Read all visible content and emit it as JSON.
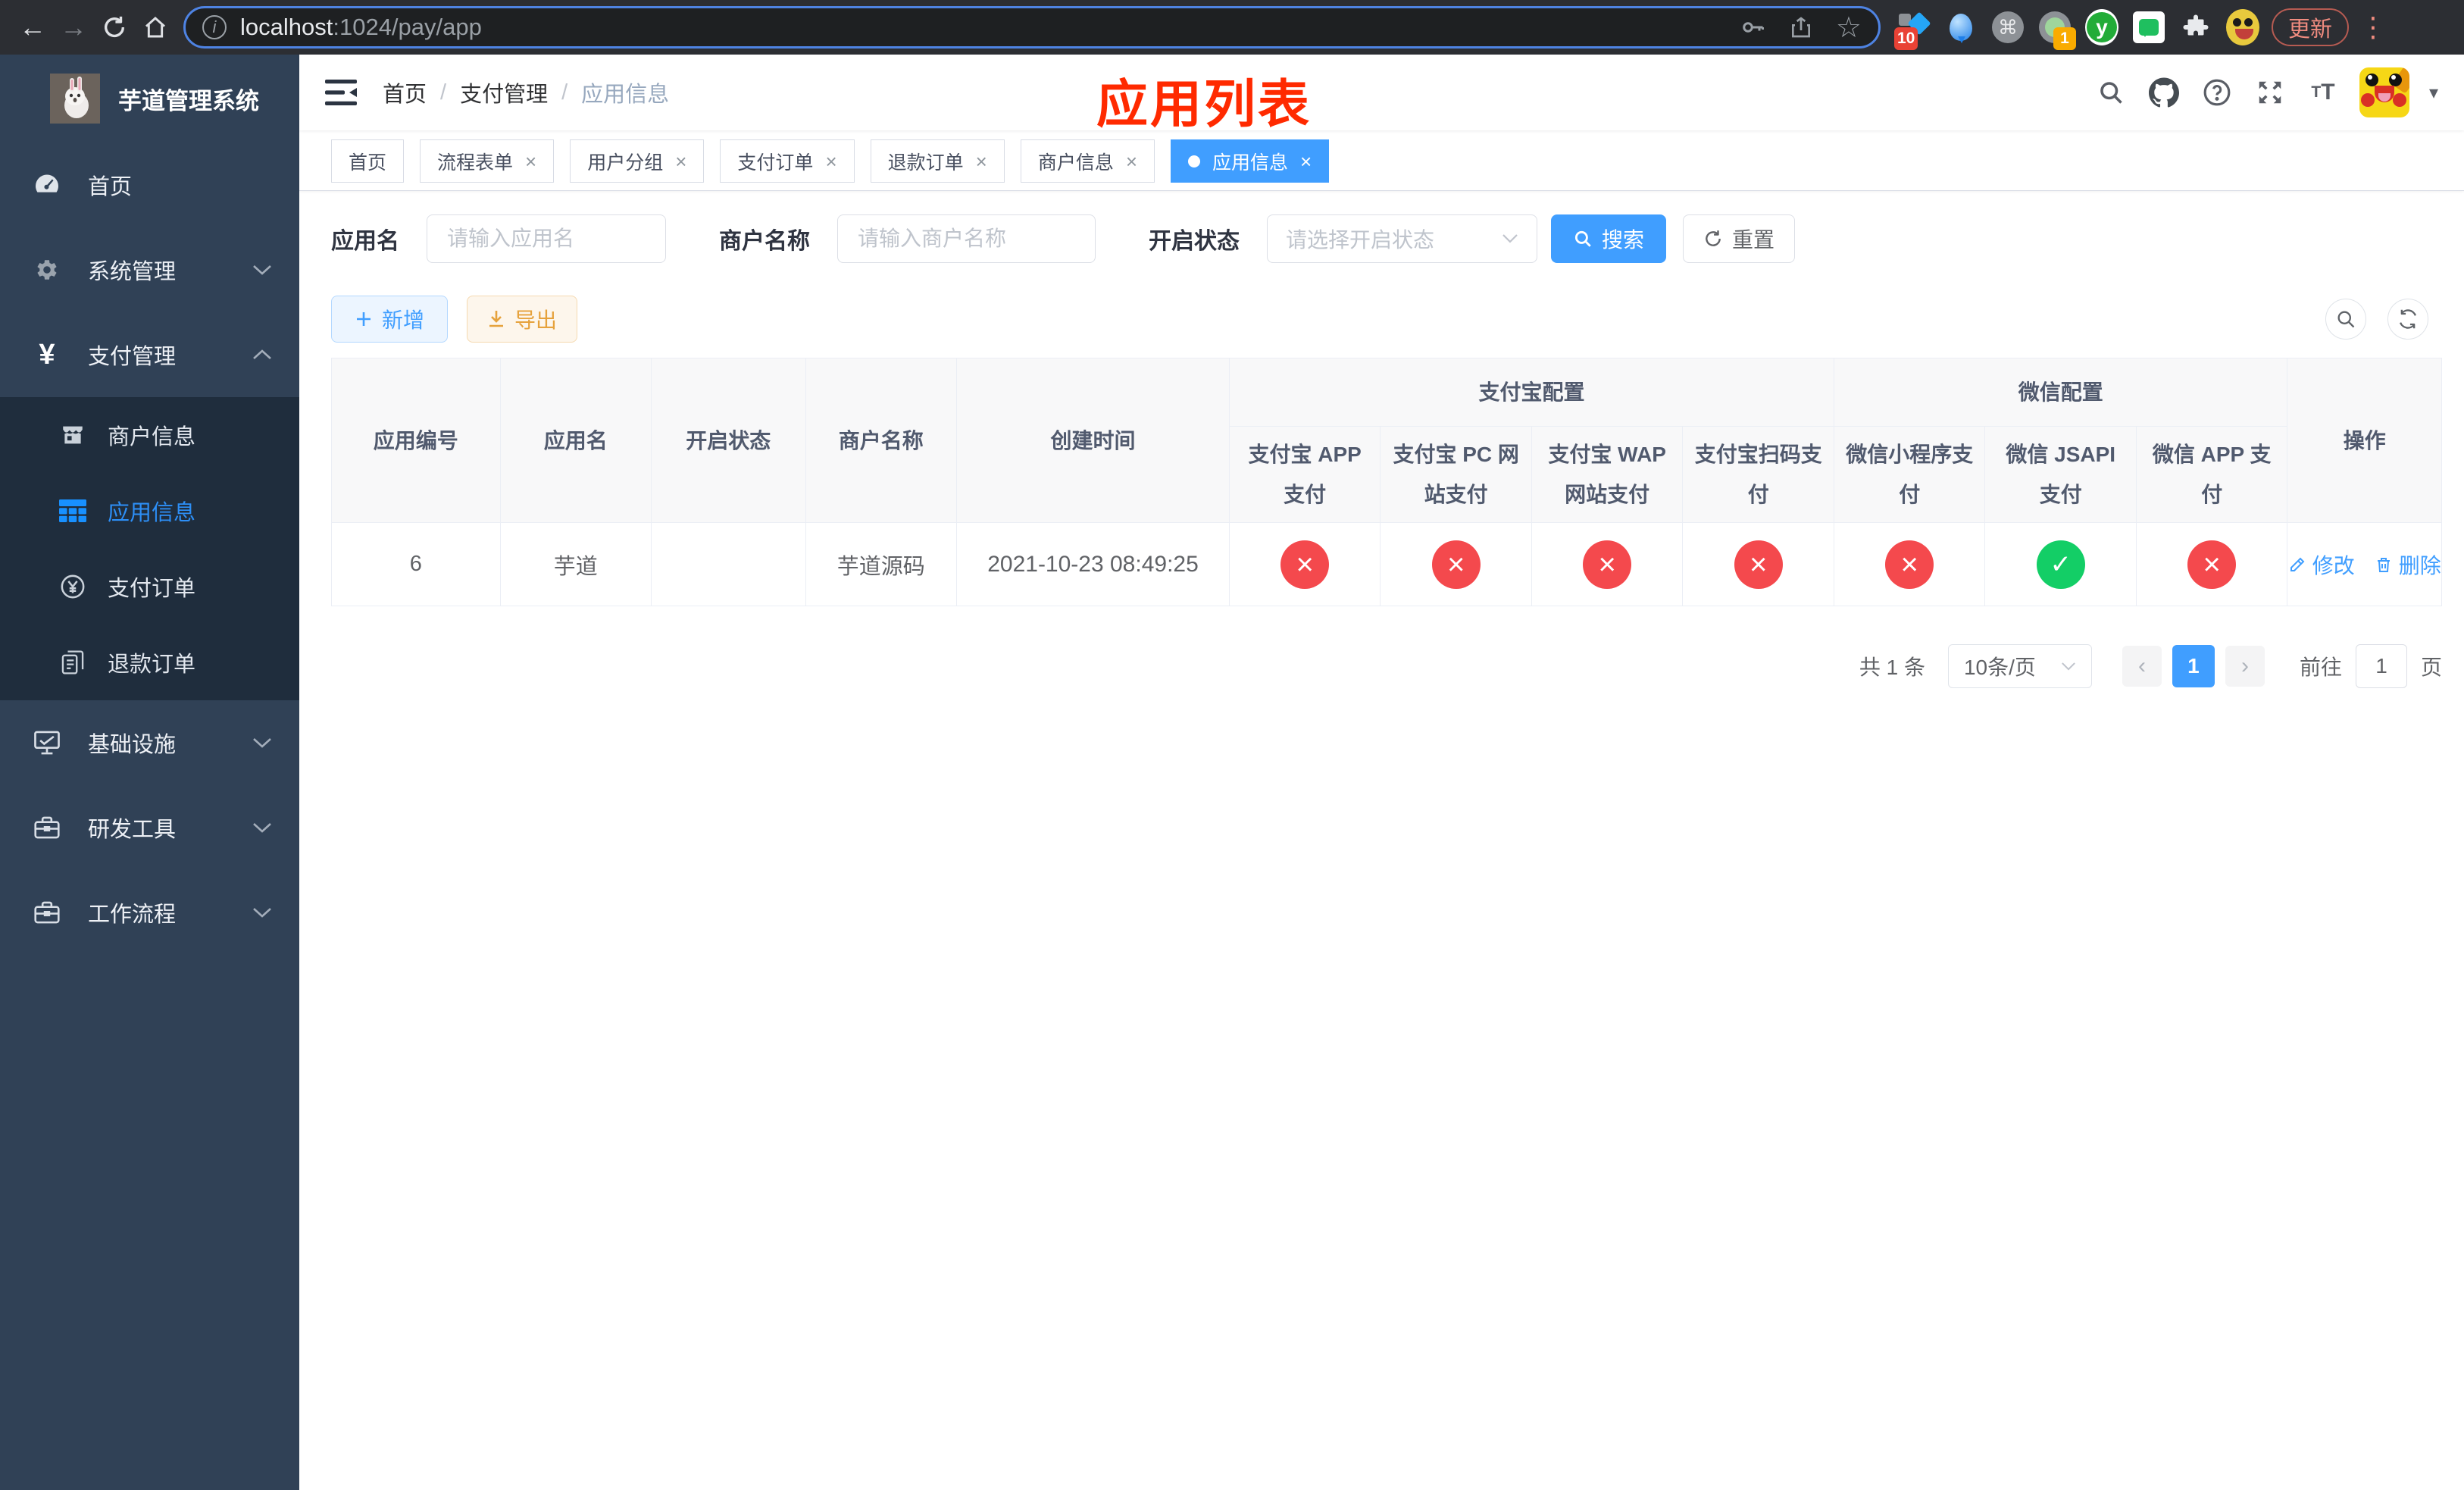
{
  "colors": {
    "accent": "#409eff",
    "success": "#13ce66",
    "danger": "#f4494d",
    "warning": "#e6a23c",
    "annotation_red": "#ff2a00",
    "sidebar_bg": "#304156",
    "submenu_bg": "#1f2d3d"
  },
  "browser": {
    "url_host": "localhost",
    "url_path": ":1024/pay/app",
    "update_label": "更新",
    "ext_badge_sketch": "10",
    "ext_badge_record": "1",
    "ext_y_letter": "y",
    "cmd_glyph": "⌘"
  },
  "sidebar": {
    "title": "芋道管理系统",
    "menu": [
      {
        "label": "首页"
      },
      {
        "label": "系统管理"
      },
      {
        "label": "支付管理"
      },
      {
        "label": "基础设施"
      },
      {
        "label": "研发工具"
      },
      {
        "label": "工作流程"
      }
    ],
    "submenu": [
      {
        "label": "商户信息"
      },
      {
        "label": "应用信息"
      },
      {
        "label": "支付订单"
      },
      {
        "label": "退款订单"
      }
    ]
  },
  "navbar": {
    "breadcrumb": [
      "首页",
      "支付管理",
      "应用信息"
    ],
    "page_title": "应用列表"
  },
  "tabs": [
    {
      "label": "首页"
    },
    {
      "label": "流程表单"
    },
    {
      "label": "用户分组"
    },
    {
      "label": "支付订单"
    },
    {
      "label": "退款订单"
    },
    {
      "label": "商户信息"
    },
    {
      "label": "应用信息"
    }
  ],
  "filters": {
    "app_name_label": "应用名",
    "app_name_placeholder": "请输入应用名",
    "merchant_label": "商户名称",
    "merchant_placeholder": "请输入商户名称",
    "status_label": "开启状态",
    "status_placeholder": "请选择开启状态",
    "search_label": "搜索",
    "reset_label": "重置"
  },
  "toolbar": {
    "add_label": "新增",
    "export_label": "导出"
  },
  "table": {
    "headers": {
      "app_id": "应用编号",
      "app_name": "应用名",
      "status": "开启状态",
      "merchant": "商户名称",
      "created": "创建时间",
      "alipay_group": "支付宝配置",
      "wechat_group": "微信配置",
      "alipay_app": "支付宝 APP 支付",
      "alipay_pc": "支付宝 PC 网站支付",
      "alipay_wap": "支付宝 WAP 网站支付",
      "alipay_scan": "支付宝扫码支付",
      "wx_lite": "微信小程序支付",
      "wx_jsapi": "微信 JSAPI 支付",
      "wx_app": "微信 APP 支付",
      "actions": "操作"
    },
    "rows": [
      {
        "app_id": "6",
        "app_name": "芋道",
        "status": "on",
        "merchant": "芋道源码",
        "created": "2021-10-23 08:49:25",
        "alipay_app": "fail",
        "alipay_pc": "fail",
        "alipay_wap": "fail",
        "alipay_scan": "fail",
        "wx_lite": "fail",
        "wx_jsapi": "pass",
        "wx_app": "fail",
        "edit_label": "修改",
        "delete_label": "删除"
      }
    ]
  },
  "pagination": {
    "total_text": "共 1 条",
    "page_size": "10条/页",
    "prev_glyph": "‹",
    "next_glyph": "›",
    "current_page": "1",
    "goto_label": "前往",
    "goto_value": "1",
    "goto_suffix": "页"
  }
}
